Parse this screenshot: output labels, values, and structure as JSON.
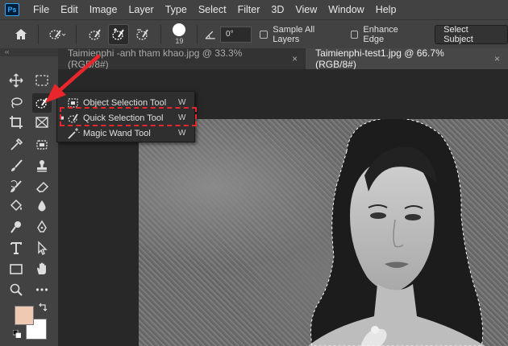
{
  "menubar": {
    "logo": "Ps",
    "items": [
      "File",
      "Edit",
      "Image",
      "Layer",
      "Type",
      "Select",
      "Filter",
      "3D",
      "View",
      "Window",
      "Help"
    ]
  },
  "options": {
    "brush_size": "19",
    "angle": "0°",
    "sample_all_layers": "Sample All Layers",
    "enhance_edge": "Enhance Edge",
    "select_subject": "Select Subject"
  },
  "toolbar": {
    "handle": "‹‹",
    "foreground_color": "#efc9b1",
    "background_color": "#ffffff"
  },
  "tabs": [
    {
      "label": "Taimienphi -anh tham khao.jpg @ 33.3% (RGB/8#)",
      "active": false
    },
    {
      "label": "Taimienphi-test1.jpg @ 66.7% (RGB/8#)",
      "active": true
    }
  ],
  "tab_close": "×",
  "flyout": {
    "items": [
      {
        "label": "Object Selection Tool",
        "key": "W",
        "selected": false
      },
      {
        "label": "Quick Selection Tool",
        "key": "W",
        "selected": true
      },
      {
        "label": "Magic Wand Tool",
        "key": "W",
        "selected": false
      }
    ],
    "bullet": "■"
  },
  "colors": {
    "annotation_red": "#e8262b",
    "panel": "#424242"
  }
}
